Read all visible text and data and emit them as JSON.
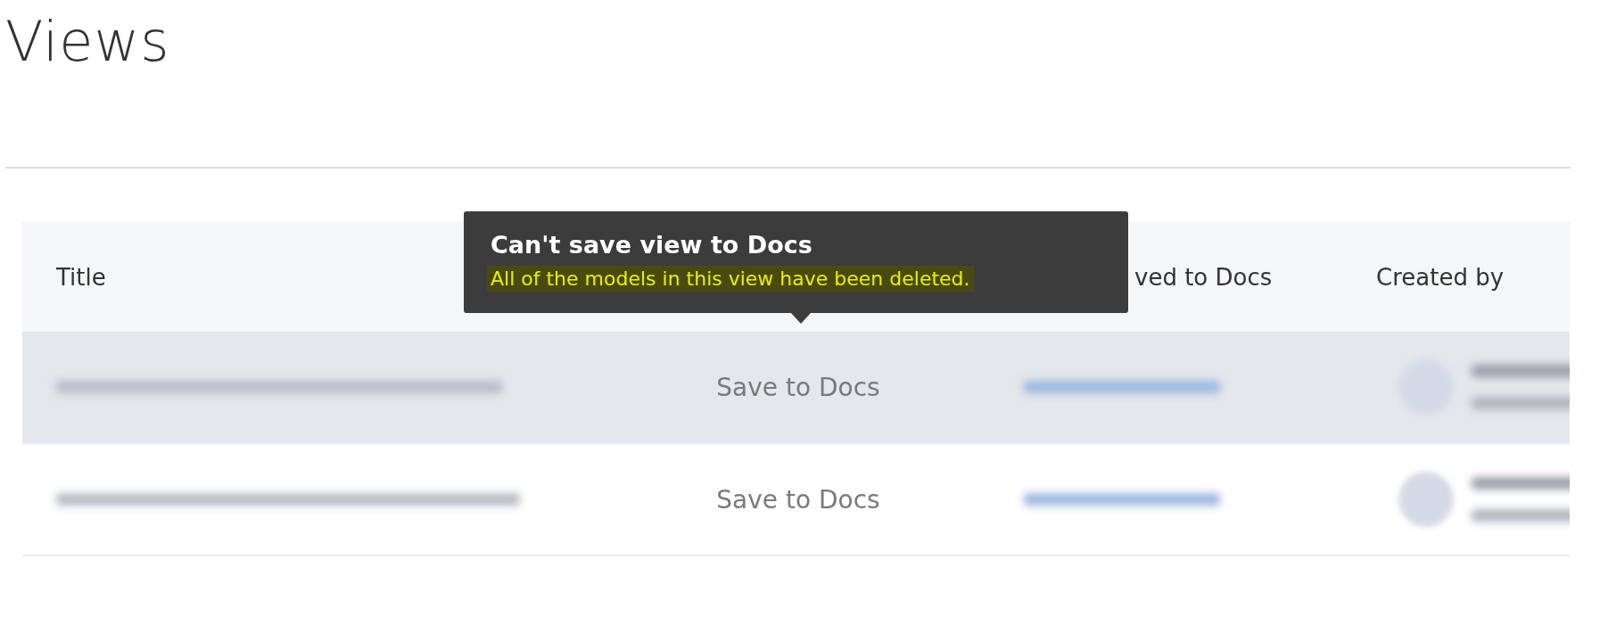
{
  "page": {
    "title": "Views"
  },
  "table": {
    "columns": [
      {
        "label": "Title"
      },
      {},
      {
        "label": "ved to Docs"
      },
      {
        "label": "Created by"
      }
    ],
    "rows": [
      {
        "highlighted": true,
        "action": {
          "label": "Save to Docs",
          "disabled": true
        }
      },
      {
        "highlighted": false,
        "action": {
          "label": "Save to Docs",
          "disabled": true
        }
      }
    ]
  },
  "tooltip": {
    "title": "Can't save view to Docs",
    "message": "All of the models in this view have been deleted."
  }
}
